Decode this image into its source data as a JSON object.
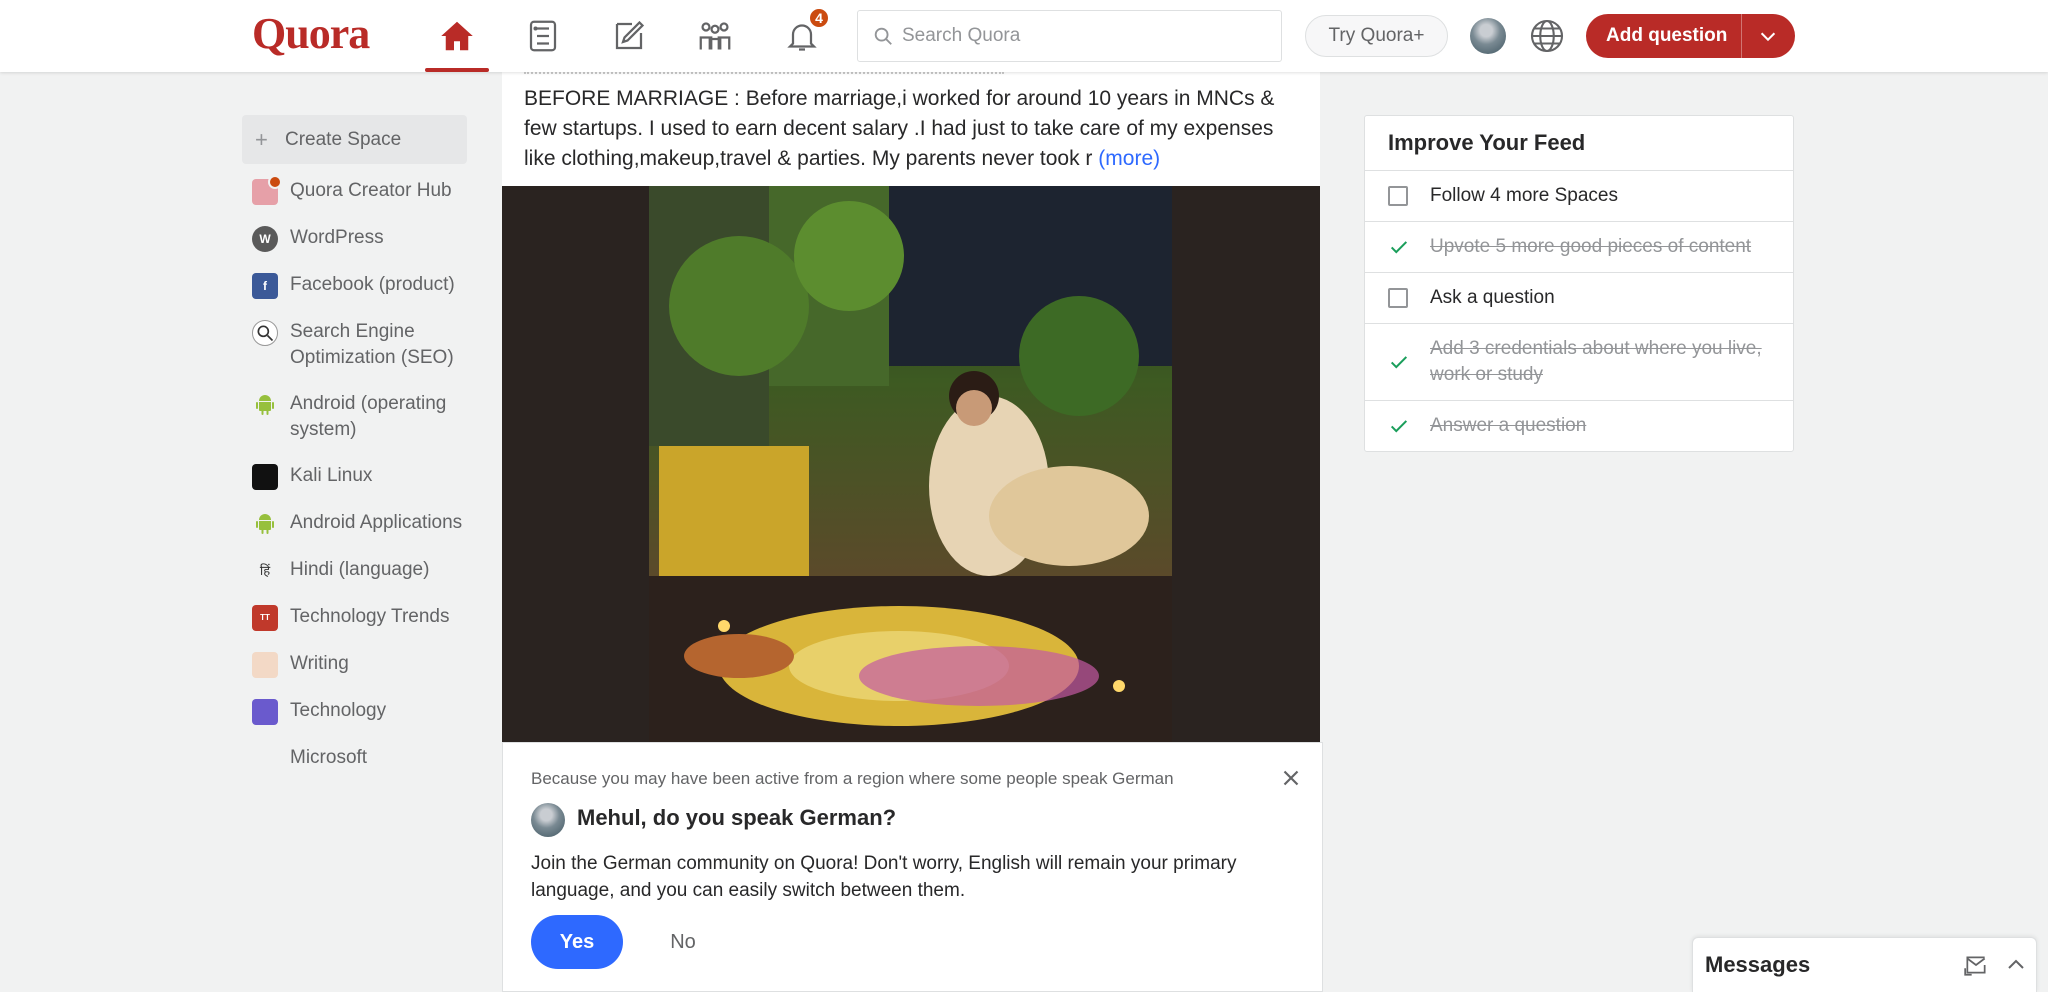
{
  "header": {
    "logo": "Quora",
    "notification_count": "4",
    "search_placeholder": "Search Quora",
    "try_plus": "Try Quora+",
    "add_question": "Add question",
    "brand_color": "#b92b27"
  },
  "sidebar": {
    "create_space": "Create Space",
    "items": [
      {
        "label": "Quora Creator Hub",
        "icon": "creator-hub-icon"
      },
      {
        "label": "WordPress",
        "icon": "wordpress-icon"
      },
      {
        "label": "Facebook (product)",
        "icon": "facebook-icon"
      },
      {
        "label": "Search Engine Optimization (SEO)",
        "icon": "seo-icon"
      },
      {
        "label": "Android (operating system)",
        "icon": "android-icon"
      },
      {
        "label": "Kali Linux",
        "icon": "kali-icon"
      },
      {
        "label": "Android Applications",
        "icon": "android-icon"
      },
      {
        "label": "Hindi (language)",
        "icon": "hindi-icon"
      },
      {
        "label": "Technology Trends",
        "icon": "tech-trends-icon"
      },
      {
        "label": "Writing",
        "icon": "writing-icon"
      },
      {
        "label": "Technology",
        "icon": "technology-icon"
      },
      {
        "label": "Microsoft",
        "icon": "microsoft-icon"
      }
    ]
  },
  "feed": {
    "body_text": "BEFORE MARRIAGE : Before marriage,i worked for around 10 years in MNCs & few startups. I used to earn decent salary .I had just to take care of my expenses like clothing,makeup,travel & parties. My parents never took r",
    "more_link": "(more)"
  },
  "language_prompt": {
    "reason": "Because you may have been active from a region where some people speak German",
    "title": "Mehul, do you speak German?",
    "body": "Join the German community on Quora! Don't worry, English will remain your primary language, and you can easily switch between them.",
    "yes": "Yes",
    "no": "No"
  },
  "improve_feed": {
    "title": "Improve Your Feed",
    "items": [
      {
        "label": "Follow 4 more Spaces",
        "done": false
      },
      {
        "label": "Upvote 5 more good pieces of content",
        "done": true
      },
      {
        "label": "Ask a question",
        "done": false
      },
      {
        "label": "Add 3 credentials about where you live, work or study",
        "done": true
      },
      {
        "label": "Answer a question",
        "done": true
      }
    ]
  },
  "messages": {
    "title": "Messages"
  }
}
